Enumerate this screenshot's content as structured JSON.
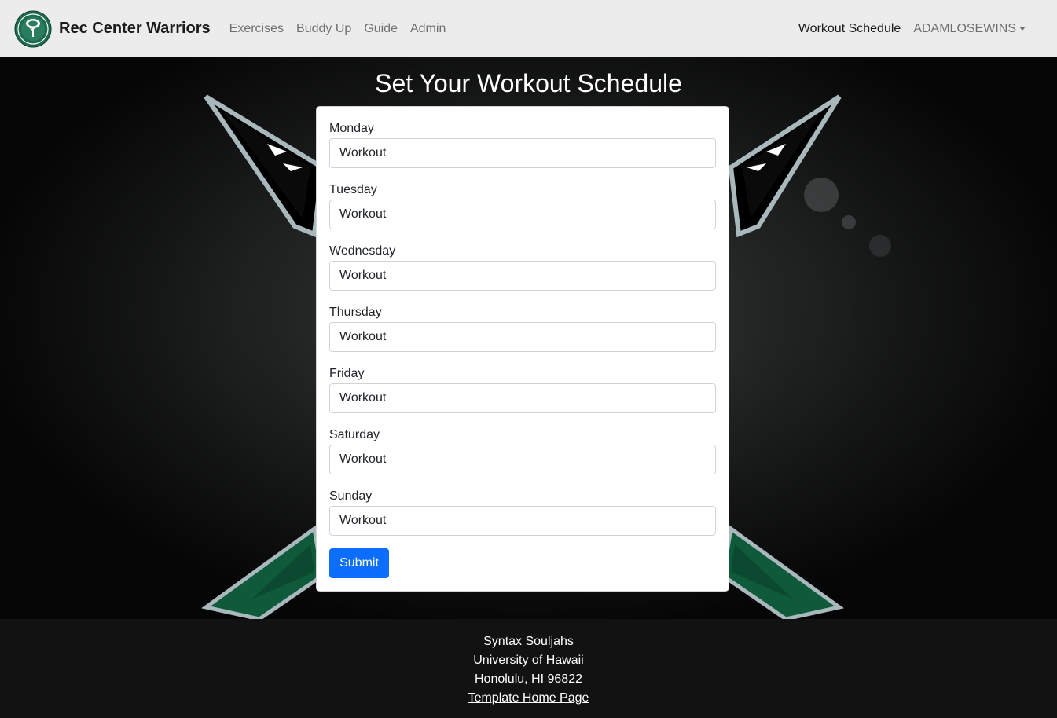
{
  "brand": {
    "name": "Rec Center Warriors",
    "logo_icon": "rec-center-tree-logo",
    "logo_color": "#1e6b50"
  },
  "nav": {
    "left": [
      "Exercises",
      "Buddy Up",
      "Guide",
      "Admin"
    ],
    "schedule": "Workout Schedule",
    "user": "ADAMLOSEWINS"
  },
  "page": {
    "title": "Set Your Workout Schedule"
  },
  "form": {
    "fields": [
      {
        "label": "Monday",
        "value": "Workout"
      },
      {
        "label": "Tuesday",
        "value": "Workout"
      },
      {
        "label": "Wednesday",
        "value": "Workout"
      },
      {
        "label": "Thursday",
        "value": "Workout"
      },
      {
        "label": "Friday",
        "value": "Workout"
      },
      {
        "label": "Saturday",
        "value": "Workout"
      },
      {
        "label": "Sunday",
        "value": "Workout"
      }
    ],
    "submit_label": "Submit",
    "submit_color": "#0d6efd"
  },
  "footer": {
    "line1": "Syntax Souljahs",
    "line2": "University of Hawaii",
    "line3": "Honolulu, HI 96822",
    "link": "Template Home Page"
  },
  "colors": {
    "accent_green": "#0f5a3a",
    "navbar_bg": "#ececec"
  }
}
